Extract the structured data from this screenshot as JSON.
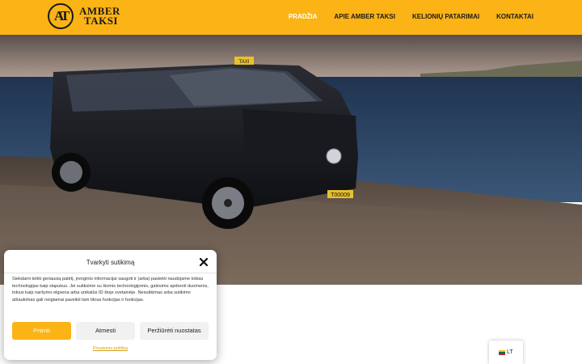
{
  "header": {
    "logo": {
      "line1": "AMBER",
      "line2": "TAKSI",
      "monogram": "AT"
    },
    "nav": [
      {
        "label": "PRADŽIA",
        "active": true
      },
      {
        "label": "APIE AMBER TAKSI",
        "active": false
      },
      {
        "label": "KELIONIŲ PATARIMAI",
        "active": false
      },
      {
        "label": "KONTAKTAI",
        "active": false
      }
    ]
  },
  "hero": {
    "image": "black van taxi parked by the sea",
    "roof_sign": "TAXI",
    "plate": "T00009"
  },
  "cookie_dialog": {
    "title": "Tvarkyti sutikimą",
    "close_icon": "close-icon",
    "text": "Siekdami teikti geriausią patirtį, įrenginio informacijai saugoti ir (arba) pasiekti naudojame tokias technologijas kaip slapukus. Jei sutiksime su šiomis technologijomis, galėsime apdoroti duomenis, tokius kaip naršymo elgsena arba unikalūs ID šioje svetainėje. Nesutikimas arba sutikimo atšaukimas gali neigiamai paveikti tam tikras funkcijas ir funkcijas.",
    "accept_label": "Priimti",
    "deny_label": "Atmesti",
    "prefs_label": "Peržiūrėti nuostatas",
    "policy_link": "Privatumo politika"
  },
  "language": {
    "code": "LT",
    "flag_icon": "lithuania-flag-icon"
  },
  "colors": {
    "brand": "#fbb315",
    "text": "#1a1a1a"
  }
}
